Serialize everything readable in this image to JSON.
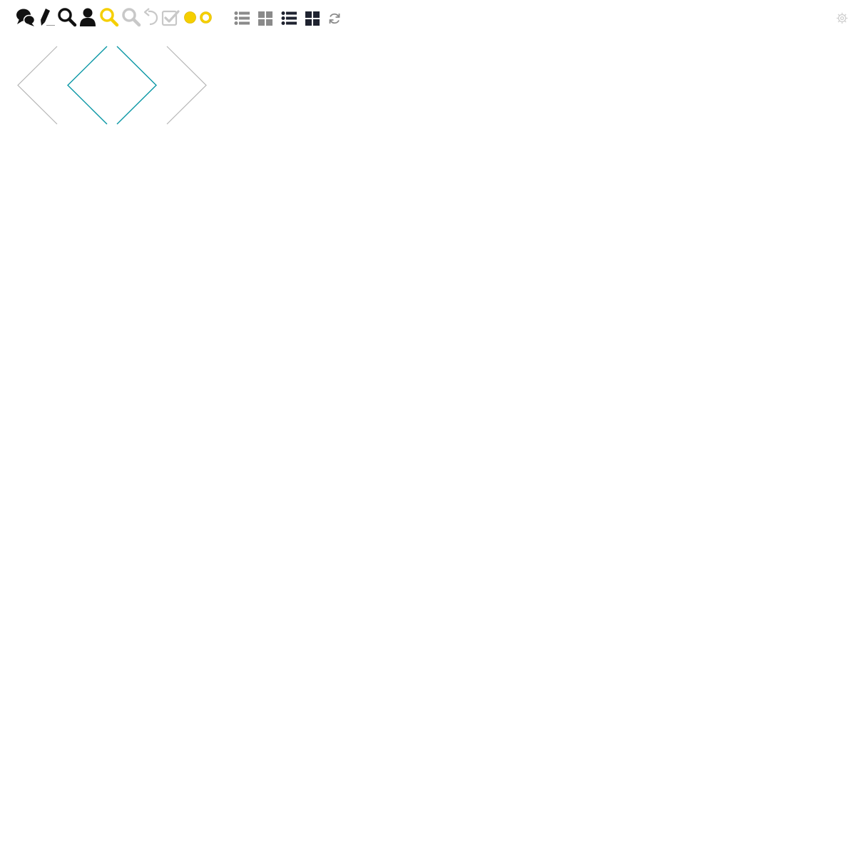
{
  "toolbar": {
    "left_icons": [
      "chat-bubbles-icon",
      "pencil-icon",
      "search-icon",
      "user-icon",
      "search-highlighted-icon",
      "search-disabled-icon",
      "undo-icon",
      "checkbox-icon",
      "filled-circle-icon",
      "ring-icon"
    ],
    "view_icons": [
      "list-view-icon",
      "grid-view-icon",
      "list-view-active-icon",
      "grid-view-active-icon",
      "refresh-icon"
    ],
    "right_icons": [
      "settings-icon"
    ]
  },
  "navigator": {
    "items": [
      "previous-chevron",
      "current-diamond",
      "next-chevron"
    ]
  },
  "colors": {
    "accent_yellow": "#f5cf00",
    "teal": "#0a97a5",
    "icon_dark": "#111111",
    "icon_gray": "#8a8a8a",
    "icon_light_gray": "#c8c8c8",
    "chevron_gray": "#b5b5b5",
    "view_active": "#1f2330"
  }
}
